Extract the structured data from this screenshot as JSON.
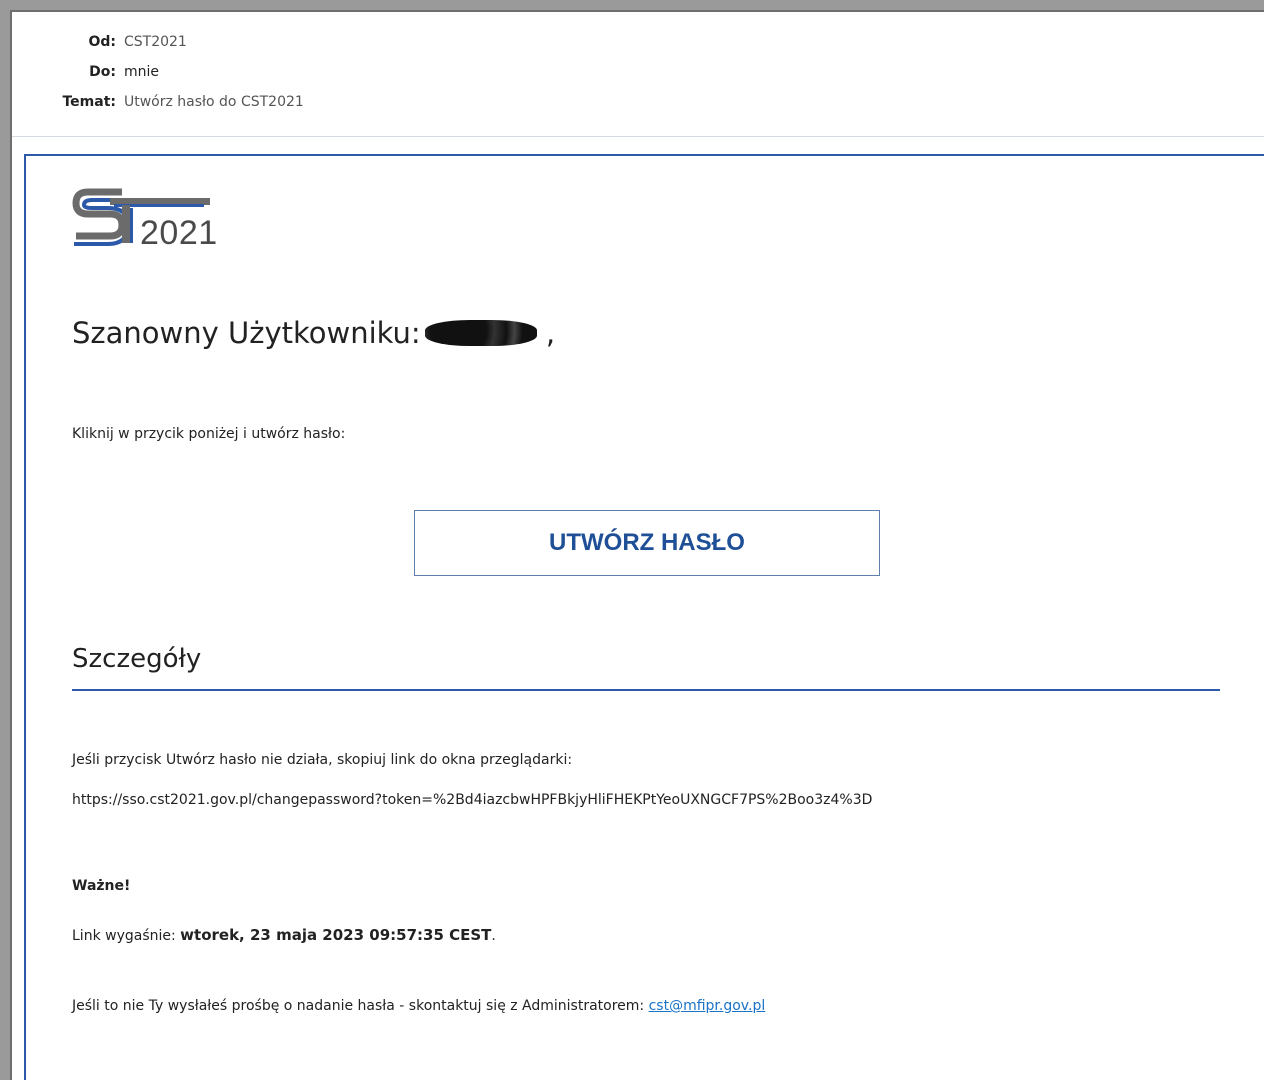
{
  "headers": {
    "from_label": "Od:",
    "from_value": "CST2021",
    "to_label": "Do:",
    "to_value": "mnie",
    "subject_label": "Temat:",
    "subject_value": "Utwórz hasło do CST2021"
  },
  "logo": {
    "year": "2021",
    "colors": {
      "gray": "#6b6b6b",
      "blue": "#2d5aa8"
    }
  },
  "greeting": {
    "text": "Szanowny Użytkowniku:",
    "suffix": ","
  },
  "intro": "Kliknij w przycik poniżej i utwórz hasło:",
  "cta_label": "UTWÓRZ HASŁO",
  "details": {
    "title": "Szczegóły",
    "fallback_text": "Jeśli przycisk Utwórz hasło nie działa, skopiuj link do okna przeglądarki:",
    "link": "https://sso.cst2021.gov.pl/changepassword?token=%2Bd4iazcbwHPFBkjyHliFHEKPtYeoUXNGCF7PS%2Boo3z4%3D",
    "important_label": "Ważne!",
    "expiry_label": "Link wygaśnie:",
    "expiry_value": "wtorek, 23 maja 2023 09:57:35 CEST",
    "expiry_end": ".",
    "contact_text": "Jeśli to nie Ty wysłałeś prośbę o nadanie hasła - skontaktuj się z Administratorem:",
    "contact_email": "cst@mfipr.gov.pl"
  },
  "accent_color": "#2d5aa8"
}
